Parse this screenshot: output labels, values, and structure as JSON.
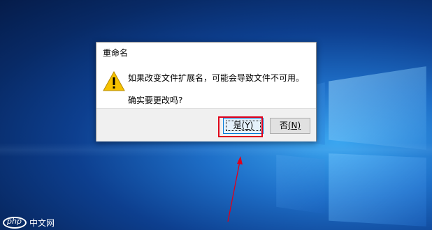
{
  "dialog": {
    "title": "重命名",
    "message": "如果改变文件扩展名，可能会导致文件不可用。",
    "question": "确实要更改吗?",
    "icon": "warning-icon",
    "buttons": {
      "yes": {
        "label": "是",
        "accel": "(Y)"
      },
      "no": {
        "label": "否",
        "accel": "(N)"
      }
    }
  },
  "annotation": {
    "highlight_color": "#e0001a",
    "target": "yes-button"
  },
  "watermark": {
    "logo": "php",
    "text": "中文网"
  },
  "colors": {
    "desktop": "#0d3f8f",
    "dialog_bg": "#f0f0f0",
    "default_button_border": "#0078d7",
    "warning_fill": "#f6c200"
  }
}
